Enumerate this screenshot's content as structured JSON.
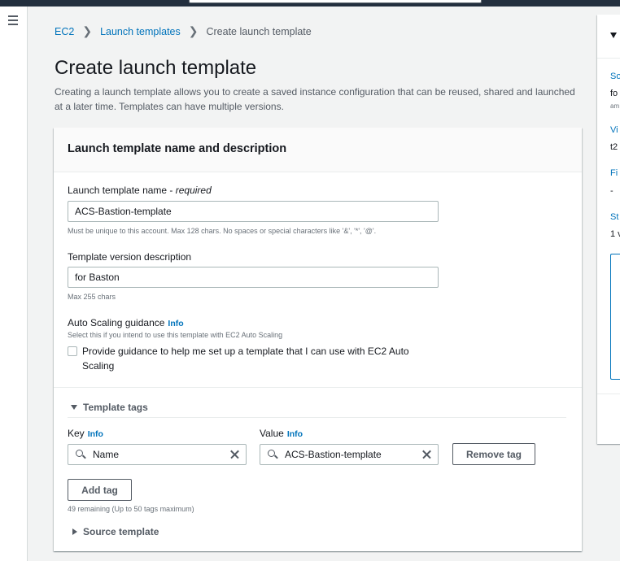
{
  "breadcrumb": {
    "items": [
      "EC2",
      "Launch templates"
    ],
    "current": "Create launch template"
  },
  "page": {
    "title": "Create launch template",
    "description": "Creating a launch template allows you to create a saved instance configuration that can be reused, shared and launched at a later time. Templates can have multiple versions."
  },
  "panel": {
    "title": "Launch template name and description",
    "name_field": {
      "label": "Launch template name - ",
      "required": "required",
      "value": "ACS-Bastion-template",
      "hint": "Must be unique to this account. Max 128 chars. No spaces or special characters like '&', '*', '@'."
    },
    "version_field": {
      "label": "Template version description",
      "value": "for Baston",
      "hint": "Max 255 chars"
    },
    "autoscaling": {
      "label": "Auto Scaling guidance",
      "info": "Info",
      "hint": "Select this if you intend to use this template with EC2 Auto Scaling",
      "checkbox_label": "Provide guidance to help me set up a template that I can use with EC2 Auto Scaling",
      "checked": false
    },
    "tags": {
      "title": "Template tags",
      "key_label": "Key",
      "value_label": "Value",
      "info": "Info",
      "key_value": "Name",
      "value_value": "ACS-Bastion-template",
      "remove_label": "Remove tag",
      "add_label": "Add tag",
      "remaining": "49 remaining (Up to 50 tags maximum)"
    },
    "source_template": "Source template"
  },
  "side_panel": {
    "items": [
      {
        "label": "So",
        "value": "fo",
        "sub": "am"
      },
      {
        "label": "Vi",
        "value": "t2"
      },
      {
        "label": "Fi",
        "value": "-"
      },
      {
        "label": "St",
        "value": "1 v"
      }
    ]
  }
}
